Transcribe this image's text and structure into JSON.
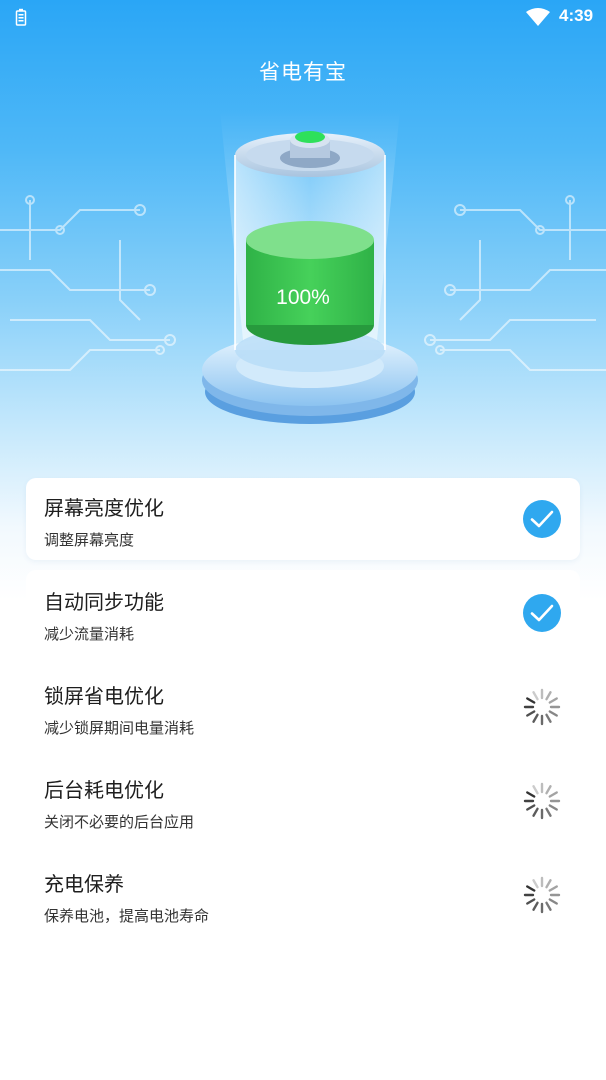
{
  "status_bar": {
    "time": "4:39",
    "battery_icon": "battery-icon",
    "wifi_icon": "wifi-icon"
  },
  "header": {
    "title": "省电有宝"
  },
  "battery": {
    "percent_label": "100%",
    "level": 1.0,
    "liquid_color": "#3dc64e",
    "cap_color": "#2ee05a"
  },
  "colors": {
    "accent": "#2fa8ef",
    "header_top": "#2aa6f6"
  },
  "optimizations": [
    {
      "title": "屏幕亮度优化",
      "subtitle": "调整屏幕亮度",
      "state": "done",
      "icon": "check-circle-icon"
    },
    {
      "title": "自动同步功能",
      "subtitle": "减少流量消耗",
      "state": "done",
      "icon": "check-circle-icon"
    },
    {
      "title": "锁屏省电优化",
      "subtitle": "减少锁屏期间电量消耗",
      "state": "loading",
      "icon": "spinner-icon"
    },
    {
      "title": "后台耗电优化",
      "subtitle": "关闭不必要的后台应用",
      "state": "loading",
      "icon": "spinner-icon"
    },
    {
      "title": "充电保养",
      "subtitle": "保养电池，提高电池寿命",
      "state": "loading",
      "icon": "spinner-icon"
    }
  ]
}
